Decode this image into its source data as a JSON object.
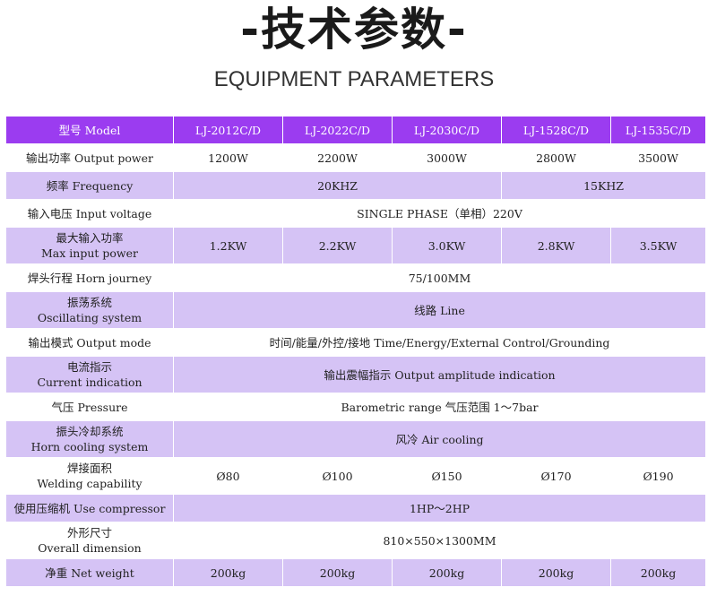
{
  "title_cn": "-技术参数-",
  "title_en": "EQUIPMENT PARAMETERS",
  "header": {
    "label": "型号 Model",
    "models": [
      "LJ-2012C/D",
      "LJ-2022C/D",
      "LJ-2030C/D",
      "LJ-1528C/D",
      "LJ-1535C/D"
    ]
  },
  "rows": {
    "output_power": {
      "label": "输出功率 Output power",
      "values": [
        "1200W",
        "2200W",
        "3000W",
        "2800W",
        "3500W"
      ]
    },
    "frequency": {
      "label": "频率 Frequency",
      "group1": "20KHZ",
      "group2": "15KHZ"
    },
    "input_voltage": {
      "label": "输入电压 Input voltage",
      "value": "SINGLE PHASE（单相）220V"
    },
    "max_input_power": {
      "label_cn": "最大输入功率",
      "label_en": "Max input power",
      "values": [
        "1.2KW",
        "2.2KW",
        "3.0KW",
        "2.8KW",
        "3.5KW"
      ]
    },
    "horn_journey": {
      "label": "焊头行程 Horn journey",
      "value": "75/100MM"
    },
    "oscillating_system": {
      "label_cn": "振荡系统",
      "label_en": "Oscillating system",
      "value": "线路 Line"
    },
    "output_mode": {
      "label": "输出模式 Output mode",
      "value": "时间/能量/外控/接地 Time/Energy/External Control/Grounding"
    },
    "current_indication": {
      "label_cn": "电流指示",
      "label_en": "Current indication",
      "value": "输出震幅指示 Output amplitude indication"
    },
    "pressure": {
      "label": "气压 Pressure",
      "value": "Barometric range 气压范围 1～7bar"
    },
    "horn_cooling": {
      "label_cn": "振头冷却系统",
      "label_en": "Horn cooling system",
      "value": "风冷 Air cooling"
    },
    "welding_capability": {
      "label_cn": "焊接面积",
      "label_en": "Welding capability",
      "values": [
        "Ø80",
        "Ø100",
        "Ø150",
        "Ø170",
        "Ø190"
      ]
    },
    "use_compressor": {
      "label": "使用压缩机 Use compressor",
      "value": "1HP～2HP"
    },
    "overall_dimension": {
      "label_cn": "外形尺寸",
      "label_en": "Overall dimension",
      "value": "810×550×1300MM"
    },
    "net_weight": {
      "label": "净重 Net weight",
      "values": [
        "200kg",
        "200kg",
        "200kg",
        "200kg",
        "200kg"
      ]
    }
  },
  "colors": {
    "header_bg": "#9b3cf0",
    "lavender_row": "#d5c3f5",
    "white_row": "#ffffff"
  }
}
